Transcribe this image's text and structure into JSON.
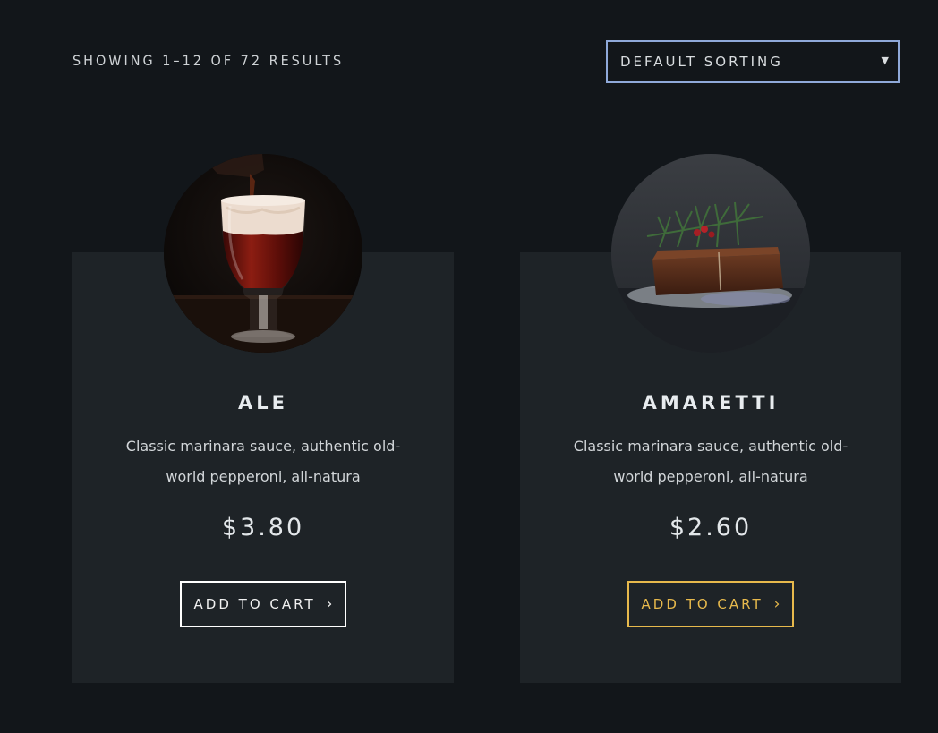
{
  "toolbar": {
    "results_text": "SHOWING 1–12 OF 72 RESULTS",
    "sort": {
      "selected": "DEFAULT SORTING",
      "caret_icon": "caret-down-icon"
    }
  },
  "products": [
    {
      "title": "ALE",
      "description": "Classic marinara sauce, authentic old-world pepperoni, all-natura",
      "price": "$3.80",
      "button_label": "ADD TO CART",
      "button_icon": "chevron-right-icon",
      "button_color": "#ffffff",
      "image": "beer-glass-photo"
    },
    {
      "title": "AMARETTI",
      "description": "Classic marinara sauce, authentic old-world pepperoni, all-natura",
      "price": "$2.60",
      "button_label": "ADD TO CART",
      "button_icon": "chevron-right-icon",
      "button_color": "#e7b94c",
      "image": "cake-with-pine-photo"
    }
  ],
  "colors": {
    "background": "#12161a",
    "card": "#1e2327",
    "accent": "#e7b94c",
    "select_border": "#8fa9d9"
  }
}
